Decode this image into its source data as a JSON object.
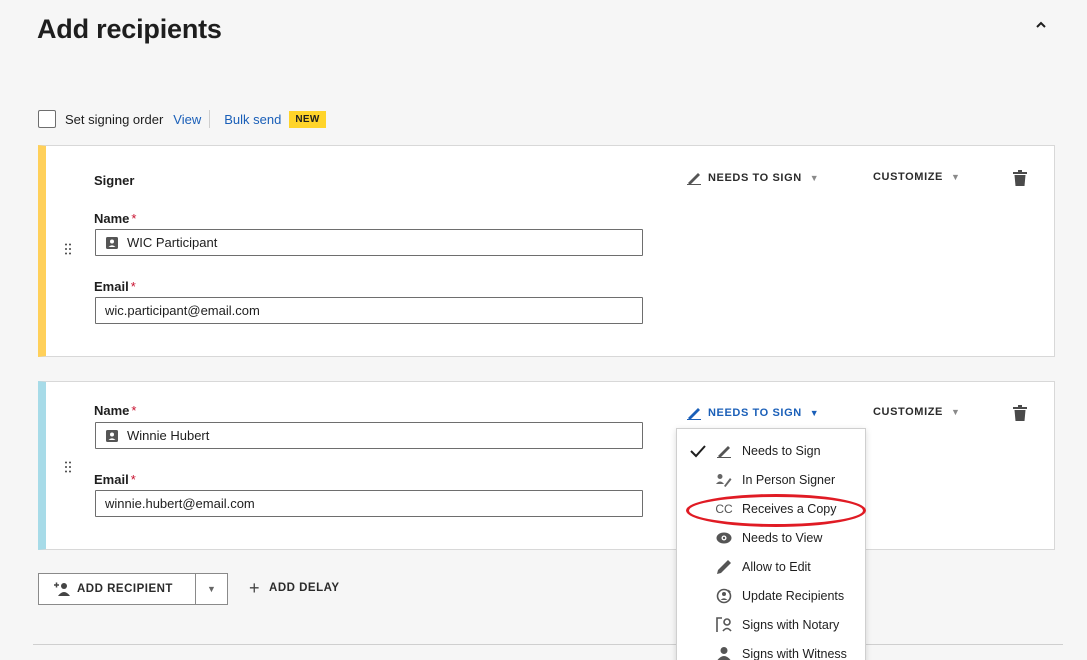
{
  "header": {
    "title": "Add recipients"
  },
  "signing_order": {
    "label": "Set signing order",
    "view_link": "View",
    "bulk_send_link": "Bulk send",
    "new_badge": "NEW"
  },
  "recipients": [
    {
      "role_label": "Signer",
      "name_label": "Name",
      "name_value": "WIC Participant",
      "email_label": "Email",
      "email_value": "wic.participant@email.com",
      "action_label": "NEEDS TO SIGN",
      "customize_label": "CUSTOMIZE",
      "accent_color": "#ffd05a"
    },
    {
      "name_label": "Name",
      "name_value": "Winnie Hubert",
      "email_label": "Email",
      "email_value": "winnie.hubert@email.com",
      "action_label": "NEEDS TO SIGN",
      "customize_label": "CUSTOMIZE",
      "accent_color": "#a7dbe8"
    }
  ],
  "required_marker": "*",
  "action_menu": {
    "items": [
      {
        "label": "Needs to Sign",
        "icon": "pen-icon",
        "selected": true
      },
      {
        "label": "In Person Signer",
        "icon": "in-person-icon"
      },
      {
        "label": "Receives a Copy",
        "icon": "cc-icon",
        "icon_text": "CC",
        "highlighted": true
      },
      {
        "label": "Needs to View",
        "icon": "eye-icon"
      },
      {
        "label": "Allow to Edit",
        "icon": "pencil-icon"
      },
      {
        "label": "Update Recipients",
        "icon": "update-recipients-icon"
      },
      {
        "label": "Signs with Notary",
        "icon": "notary-icon"
      },
      {
        "label": "Signs with Witness",
        "icon": "witness-icon"
      }
    ]
  },
  "footer": {
    "add_recipient_label": "ADD RECIPIENT",
    "add_delay_label": "ADD DELAY"
  },
  "colors": {
    "link": "#1a5fb8",
    "badge": "#ffd42a",
    "highlight_ring": "#e01b24",
    "required": "#c8102e"
  }
}
